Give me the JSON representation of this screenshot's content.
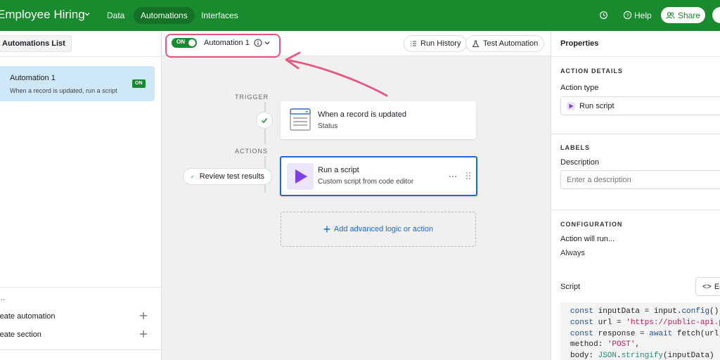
{
  "app": {
    "title": "Employee Hiring",
    "nav": [
      "Data",
      "Automations",
      "Interfaces"
    ],
    "active_nav": "Automations",
    "help_label": "Help",
    "share_label": "Share"
  },
  "sidebar": {
    "tab_label": "Automations List",
    "automations": [
      {
        "name": "Automation 1",
        "description": "When a record is updated, run a script",
        "status": "ON"
      }
    ],
    "footer_links": [
      "Create automation",
      "Create section"
    ],
    "truncated_header": "..."
  },
  "canvas": {
    "toggle_label": "ON",
    "automation_name": "Automation 1",
    "run_history_label": "Run History",
    "test_automation_label": "Test Automation",
    "trigger_label": "TRIGGER",
    "actions_label": "ACTIONS",
    "trigger_card": {
      "title": "When a record is updated",
      "subtitle": "Status"
    },
    "action_card": {
      "title": "Run a script",
      "subtitle": "Custom script from code editor"
    },
    "review_label": "Review test results",
    "add_logic_label": "Add advanced logic or action",
    "annotation_color": "#e8567f"
  },
  "properties": {
    "title": "Properties",
    "action_details_heading": "ACTION DETAILS",
    "action_type_label": "Action type",
    "action_type_value": "Run script",
    "labels_heading": "LABELS",
    "description_label": "Description",
    "description_placeholder": "Enter a description",
    "configuration_heading": "CONFIGURATION",
    "action_will_run_label": "Action will run...",
    "action_will_run_value": "Always",
    "script_label": "Script",
    "edit_label": "Edit",
    "code_lines": [
      "const inputData = input.config();",
      "const url = 'https://public-api.pro",
      "const response = await fetch(url, {",
      "method: 'POST',",
      "body: JSON.stringify(inputData)"
    ]
  },
  "colors": {
    "brand_green": "#198a2e",
    "selected_blue": "#1a6bd8",
    "highlight_pink": "#e8567f"
  }
}
